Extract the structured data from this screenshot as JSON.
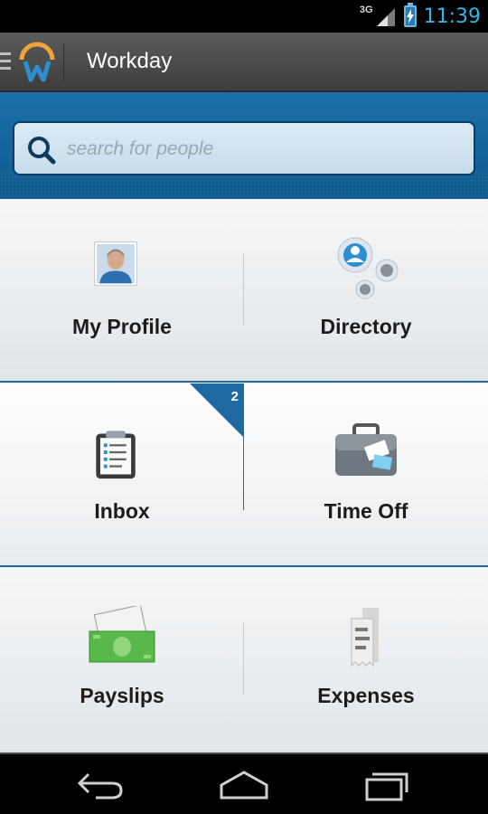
{
  "status_bar": {
    "network": "3G",
    "time": "11:39",
    "accent": "#33b5e5"
  },
  "action_bar": {
    "title": "Workday",
    "logo": "workday-logo-icon"
  },
  "search": {
    "placeholder": "search for people",
    "value": ""
  },
  "tiles": [
    {
      "label": "My Profile",
      "icon": "profile-photo-icon"
    },
    {
      "label": "Directory",
      "icon": "directory-people-icon"
    },
    {
      "label": "Inbox",
      "icon": "clipboard-inbox-icon",
      "badge": "2"
    },
    {
      "label": "Time Off",
      "icon": "suitcase-icon"
    },
    {
      "label": "Payslips",
      "icon": "money-bill-icon"
    },
    {
      "label": "Expenses",
      "icon": "receipt-icon"
    }
  ],
  "nav": {
    "back": "back-icon",
    "home": "home-icon",
    "recents": "recent-apps-icon"
  },
  "colors": {
    "brand_blue": "#1f6aa0",
    "search_band": "#1a6fa8",
    "logo_orange": "#f2a33a"
  }
}
